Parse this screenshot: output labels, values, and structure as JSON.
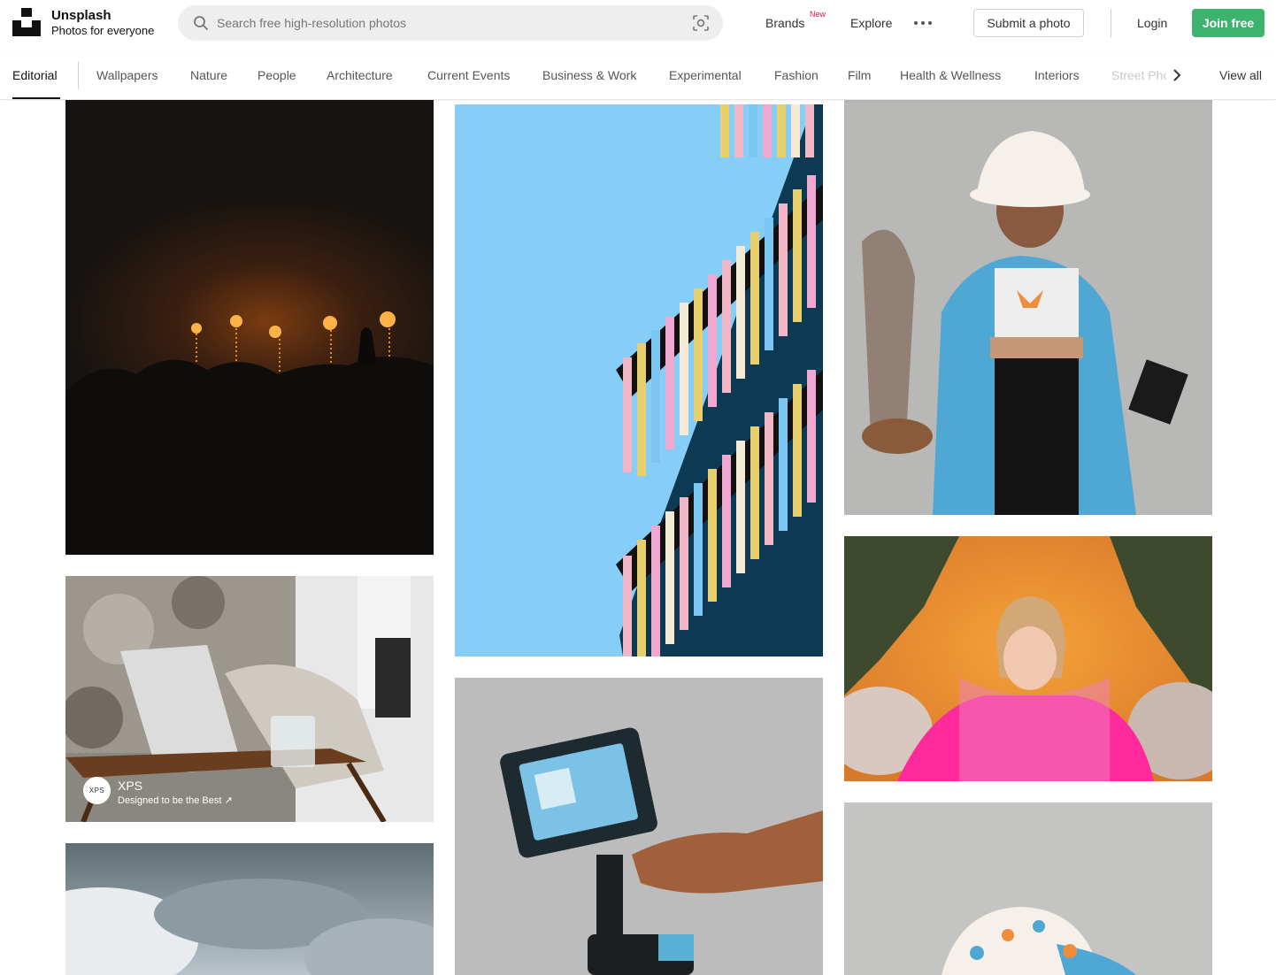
{
  "header": {
    "brand_name": "Unsplash",
    "brand_tagline": "Photos for everyone",
    "search_placeholder": "Search free high-resolution photos",
    "nav": {
      "brands": "Brands",
      "brands_badge": "New",
      "explore": "Explore",
      "submit": "Submit a photo",
      "login": "Login",
      "join": "Join free"
    }
  },
  "topics": {
    "active": "Editorial",
    "items": [
      "Wallpapers",
      "Nature",
      "People",
      "Architecture",
      "Current Events",
      "Business & Work",
      "Experimental",
      "Fashion",
      "Film",
      "Health & Wellness",
      "Interiors"
    ],
    "partial": "Street Pho",
    "view_all": "View all"
  },
  "sponsor": {
    "logo_text": "XPS",
    "name": "XPS",
    "description": "Designed to be the Best ↗"
  },
  "colors": {
    "accent_join": "#3cb46e",
    "badge_new": "#d6175f",
    "text_muted": "#767676"
  },
  "photos": [
    {
      "name": "concert-stage-photo"
    },
    {
      "name": "colorful-building-photo"
    },
    {
      "name": "butterfly-hat-woman-photo"
    },
    {
      "name": "pink-tulle-woman-photo"
    },
    {
      "name": "laptop-table-ad-photo"
    },
    {
      "name": "camera-monitor-photo"
    },
    {
      "name": "cloudy-sky-photo"
    },
    {
      "name": "butterfly-hat-closeup-photo"
    }
  ]
}
